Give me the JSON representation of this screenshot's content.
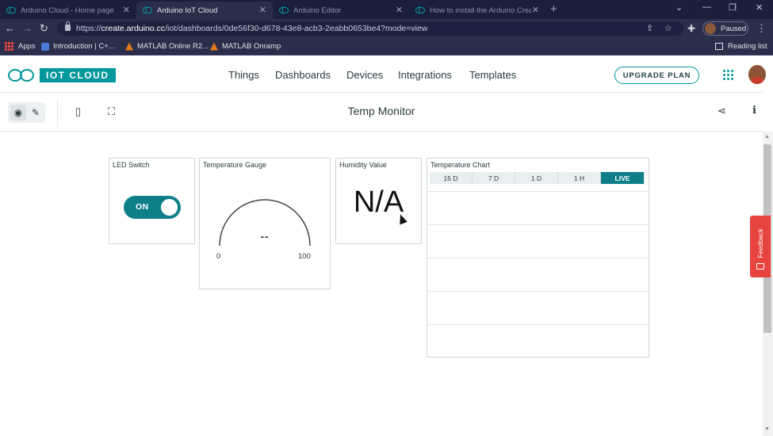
{
  "browser": {
    "tabs": [
      {
        "label": "Arduino Cloud - Home page",
        "active": false
      },
      {
        "label": "Arduino IoT Cloud",
        "active": true
      },
      {
        "label": "Arduino Editor",
        "active": false
      },
      {
        "label": "How to install the Arduino Create",
        "active": false
      }
    ],
    "url_prefix": "https://",
    "url_host": "create.arduino.cc",
    "url_path": "/iot/dashboards/0de56f30-d678-43e8-acb3-2eabb0653be4?mode=view",
    "profile_status": "Paused",
    "bookmarks": [
      {
        "label": "Apps",
        "icon": "apps-grid-icon"
      },
      {
        "label": "Introduction | C+...",
        "icon": "bookmark-page-icon"
      },
      {
        "label": "MATLAB Online R2...",
        "icon": "matlab-icon"
      },
      {
        "label": "MATLAB Onramp",
        "icon": "matlab-icon"
      }
    ],
    "reading_list": "Reading list"
  },
  "app": {
    "logo_text": "IOT CLOUD",
    "nav": [
      "Things",
      "Dashboards",
      "Devices",
      "Integrations",
      "Templates"
    ],
    "upgrade_label": "UPGRADE PLAN",
    "brand_color": "#00979d"
  },
  "toolbar": {
    "dashboard_title": "Temp Monitor",
    "icons": [
      "eye-icon",
      "edit-icon",
      "mobile-view-icon",
      "fullscreen-icon",
      "share-icon",
      "info-icon"
    ]
  },
  "widgets": {
    "led_switch": {
      "title": "LED Switch",
      "state": "ON"
    },
    "temp_gauge": {
      "title": "Temperature Gauge",
      "value": "--",
      "min": "0",
      "max": "100"
    },
    "humidity": {
      "title": "Humidity Value",
      "value": "N/A"
    },
    "temp_chart": {
      "title": "Temperature Chart",
      "ranges": [
        "15 D",
        "7 D",
        "1 D",
        "1 H",
        "LIVE"
      ],
      "active_range": "LIVE"
    }
  },
  "feedback_label": "Feedback"
}
